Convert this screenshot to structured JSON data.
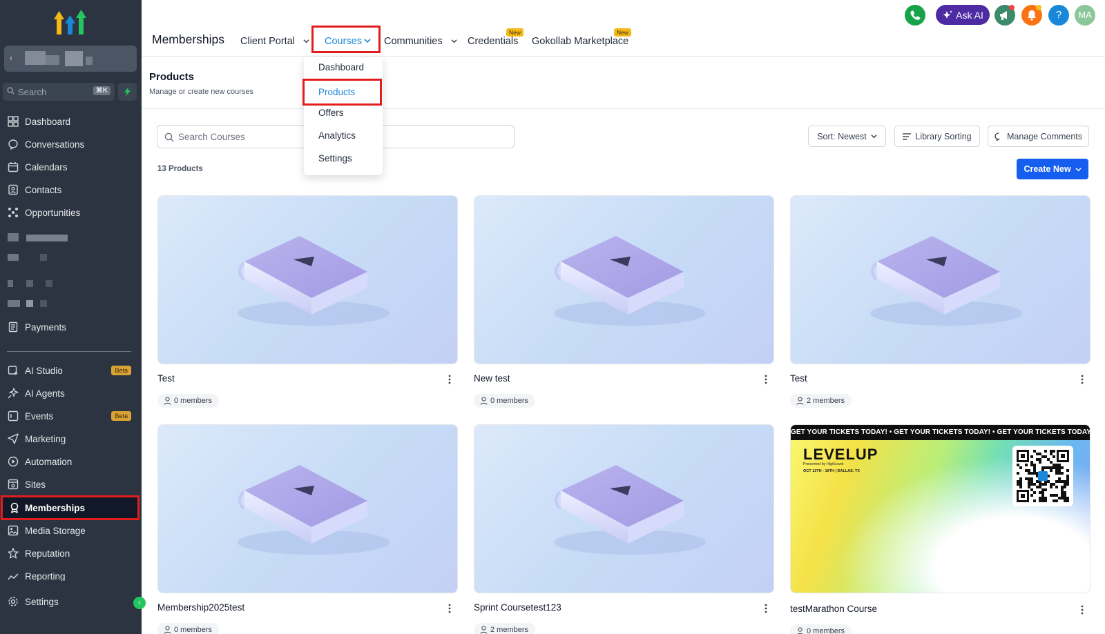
{
  "sidebar": {
    "search": {
      "placeholder": "Search",
      "shortcut": "⌘K"
    },
    "items": [
      {
        "label": "Dashboard",
        "icon": "grid-icon"
      },
      {
        "label": "Conversations",
        "icon": "chat-icon"
      },
      {
        "label": "Calendars",
        "icon": "calendar-icon"
      },
      {
        "label": "Contacts",
        "icon": "contacts-icon"
      },
      {
        "label": "Opportunities",
        "icon": "opportunities-icon"
      },
      {
        "label": "Payments",
        "icon": "payments-icon"
      }
    ],
    "items2": [
      {
        "label": "AI Studio",
        "icon": "ai-studio-icon",
        "badge": "Beta"
      },
      {
        "label": "AI Agents",
        "icon": "ai-agents-icon"
      },
      {
        "label": "Events",
        "icon": "events-icon",
        "badge": "Beta"
      },
      {
        "label": "Marketing",
        "icon": "send-icon"
      },
      {
        "label": "Automation",
        "icon": "automation-icon"
      },
      {
        "label": "Sites",
        "icon": "sites-icon"
      },
      {
        "label": "Memberships",
        "icon": "award-icon",
        "active": true
      },
      {
        "label": "Media Storage",
        "icon": "image-icon"
      },
      {
        "label": "Reputation",
        "icon": "star-icon"
      },
      {
        "label": "Reporting",
        "icon": "chart-icon"
      }
    ],
    "settings": "Settings"
  },
  "topbar": {
    "title": "Memberships",
    "tabs": {
      "client_portal": "Client Portal",
      "courses": "Courses",
      "communities": "Communities",
      "credentials": "Credentials",
      "marketplace": "Gokollab Marketplace"
    },
    "new_badge": "New",
    "ask_ai": "Ask AI",
    "avatar": "MA",
    "help": "?"
  },
  "dropdown": {
    "items": [
      "Dashboard",
      "Products",
      "Offers",
      "Analytics",
      "Settings"
    ]
  },
  "page": {
    "title": "Products",
    "subtitle": "Manage or create new courses",
    "search_placeholder": "Search Courses",
    "sort": "Sort: Newest",
    "library_sorting": "Library Sorting",
    "manage_comments": "Manage Comments",
    "count": "13 Products",
    "create_new": "Create New"
  },
  "cards": [
    {
      "title": "Test",
      "members": "0 members"
    },
    {
      "title": "New test",
      "members": "0 members"
    },
    {
      "title": "Test",
      "members": "2 members"
    },
    {
      "title": "Membership2025test",
      "members": "0 members"
    },
    {
      "title": "Sprint Coursetest123",
      "members": "2 members"
    },
    {
      "title": "testMarathon Course",
      "members": "0 members"
    }
  ],
  "levelup": {
    "banner": "GET YOUR TICKETS TODAY! • GET YOUR TICKETS TODAY! • GET YOUR TICKETS TODAY!",
    "brand": "LEVELUP",
    "presented": "Presented by HighLevel",
    "dates": "OCT 13TH - 16TH | DALLAS, TX"
  },
  "colors": {
    "sidebar_bg": "#2b3440",
    "accent_blue": "#155eef",
    "link_blue": "#1a88d8",
    "highlight_red": "#e11d1d"
  }
}
